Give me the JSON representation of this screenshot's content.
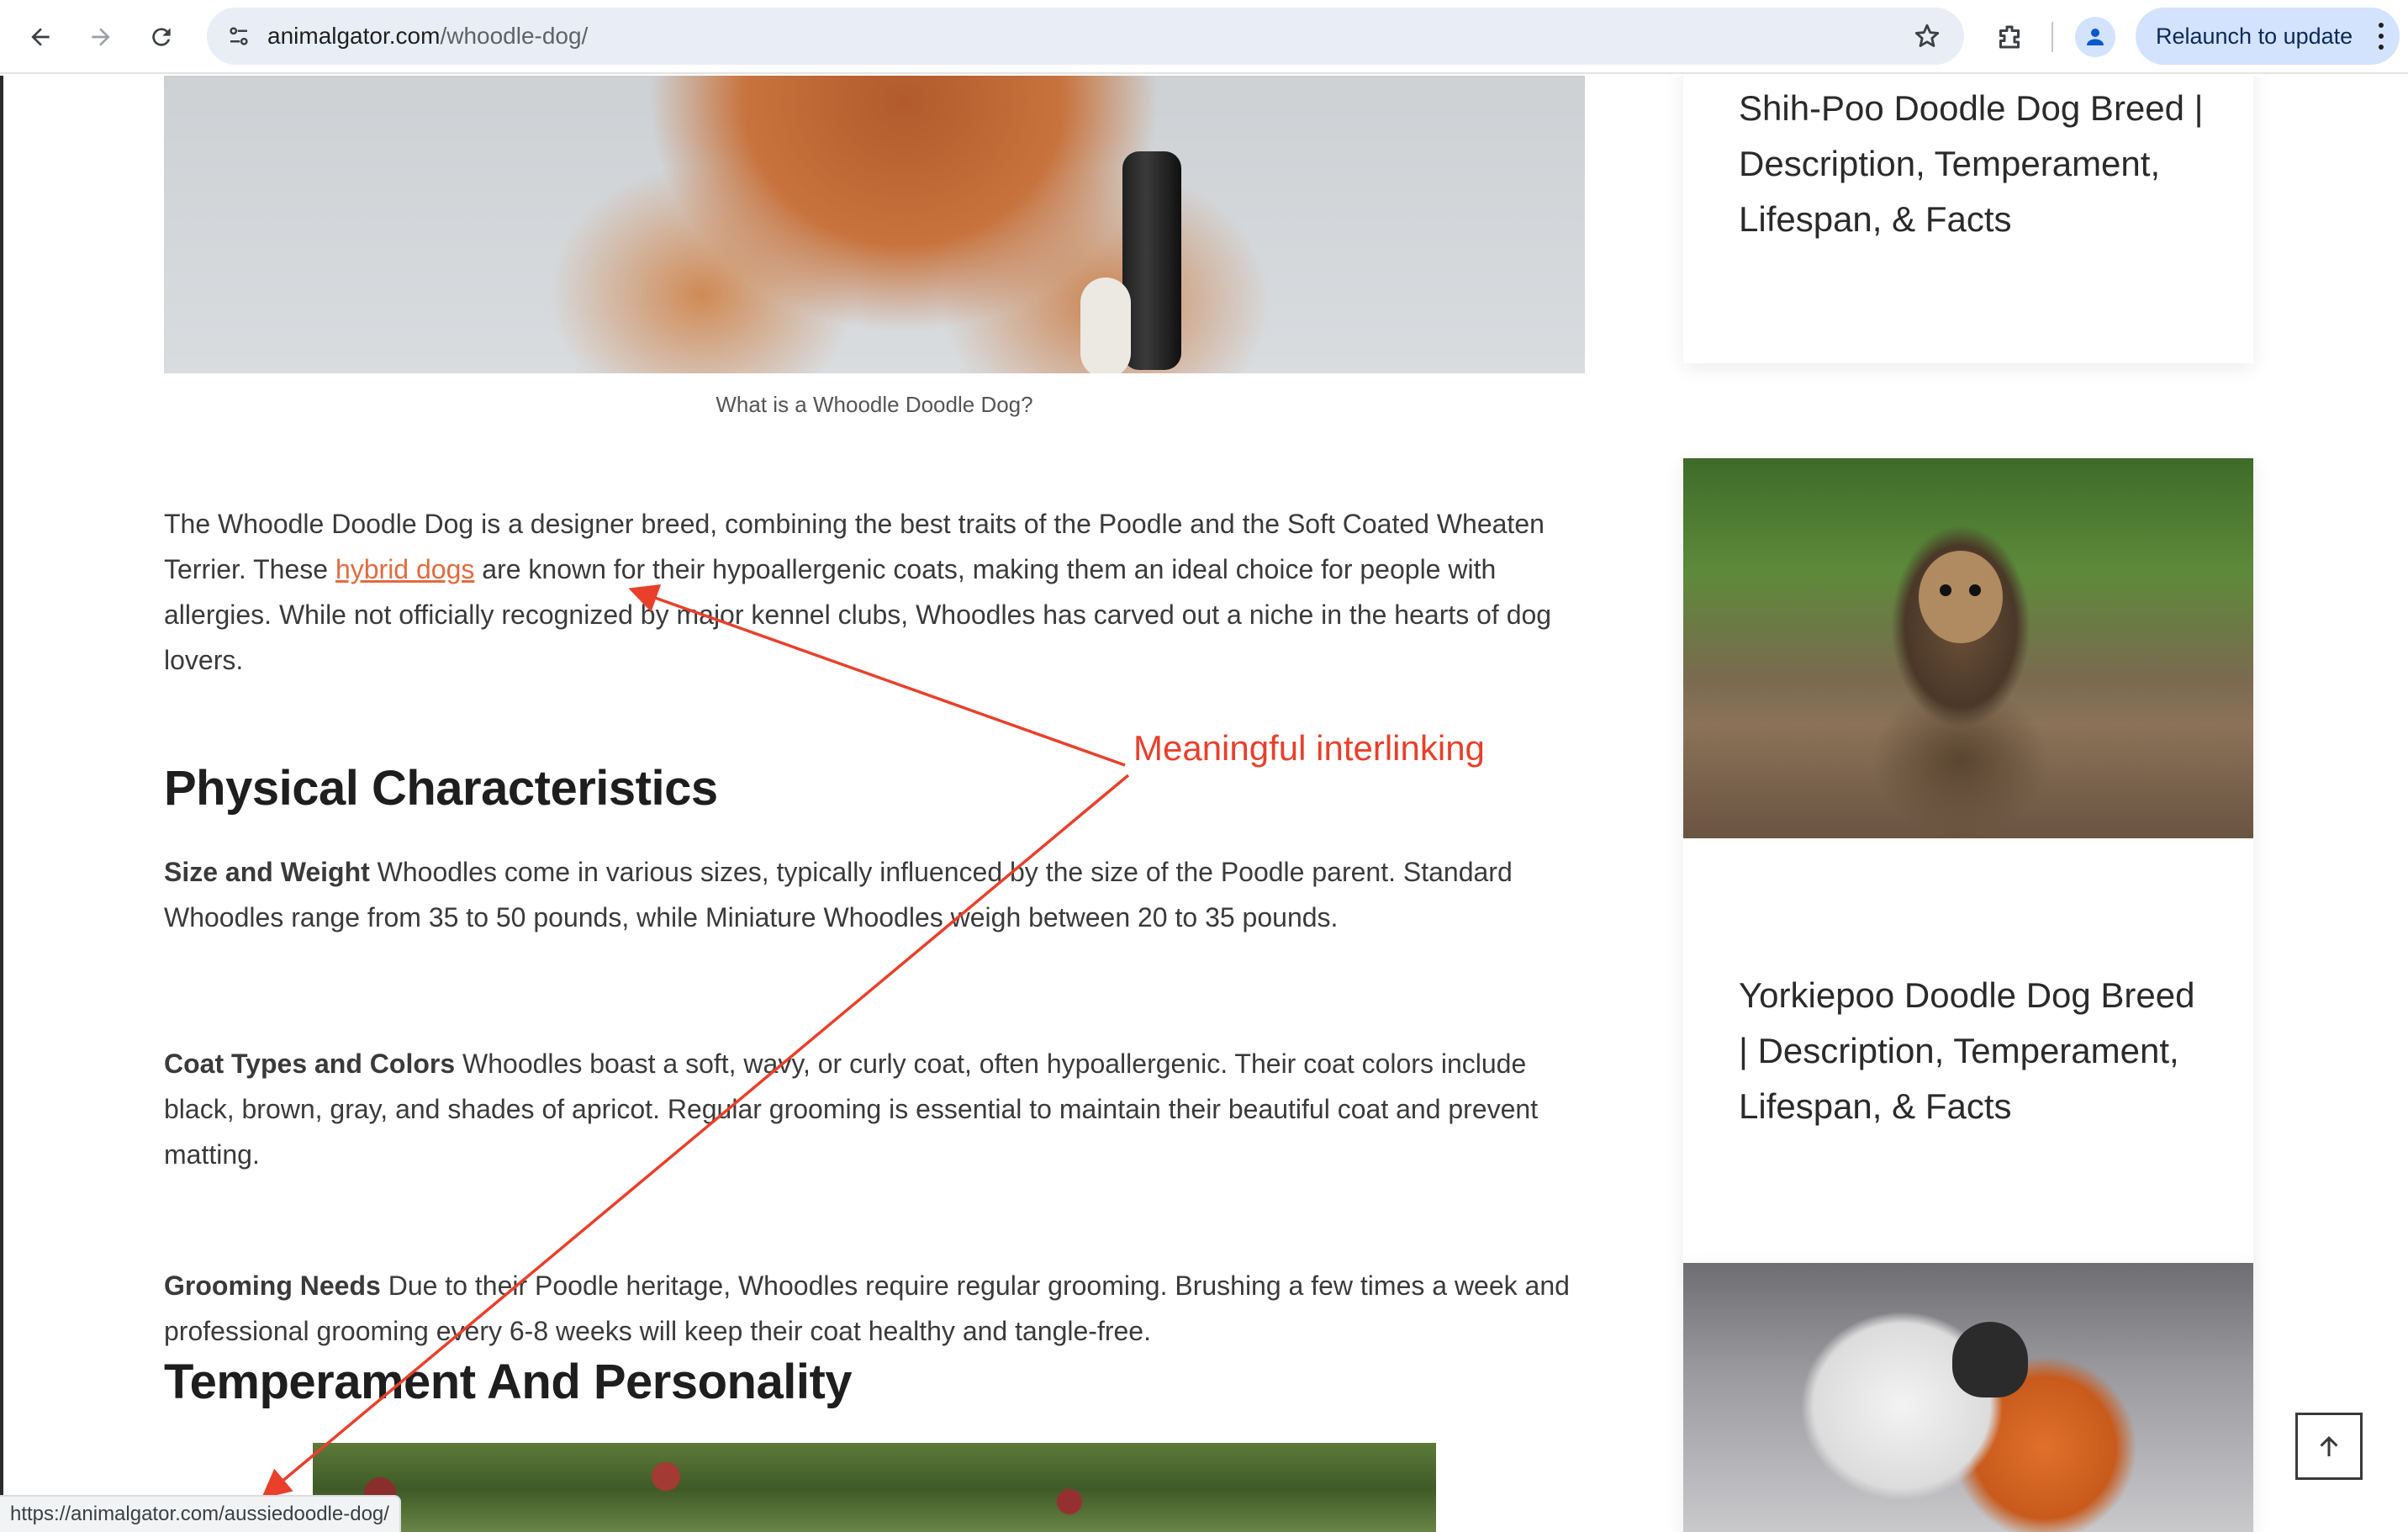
{
  "browser": {
    "url_host": "animalgator.com",
    "url_path": "/whoodle-dog/",
    "relaunch_label": "Relaunch to update",
    "status_url": "https://animalgator.com/aussiedoodle-dog/"
  },
  "article": {
    "hero_caption": "What is a Whoodle Doodle Dog?",
    "intro_before_link": "The Whoodle Doodle Dog is a designer breed, combining the best traits of the Poodle and the Soft Coated Wheaten Terrier. These ",
    "intro_link": "hybrid dogs",
    "intro_after_link": " are known for their hypoallergenic coats, making them an ideal choice for people with allergies. While not officially recognized by major kennel clubs, Whoodles has carved out a niche in the hearts of dog lovers.",
    "physical_heading": "Physical Characteristics",
    "size_label": "Size and Weight",
    "size_text": " Whoodles come in various sizes, typically influenced by the size of the Poodle parent. Standard Whoodles range from 35 to 50 pounds, while Miniature Whoodles weigh between 20 to 35 pounds.",
    "coat_label": "Coat Types and Colors",
    "coat_text": " Whoodles boast a soft, wavy, or curly coat, often hypoallergenic. Their coat colors include black, brown, gray, and shades of apricot. Regular grooming is essential to maintain their beautiful coat and prevent matting.",
    "grooming_label": "Grooming Needs",
    "grooming_text": " Due to their Poodle heritage, Whoodles require regular grooming. Brushing a few times a week and professional grooming every 6-8 weeks will keep their coat healthy and tangle-free.",
    "temperament_heading": "Temperament And Personality"
  },
  "sidebar": {
    "card1_title": "Shih-Poo Doodle Dog Breed | Description, Temperament, Lifespan, & Facts",
    "card2_title": "Yorkiepoo Doodle Dog Breed | Description, Temperament, Lifespan, & Facts"
  },
  "annotation": {
    "label": "Meaningful interlinking",
    "color": "#e8402b"
  },
  "colors": {
    "link": "#e26b3f",
    "heading": "#1e1e1e",
    "body_text": "#3a3a3a"
  },
  "icons": [
    "back-arrow-icon",
    "forward-arrow-icon",
    "reload-icon",
    "site-info-icon",
    "star-icon",
    "extensions-icon",
    "profile-icon",
    "kebab-menu-icon",
    "arrow-up-icon"
  ]
}
